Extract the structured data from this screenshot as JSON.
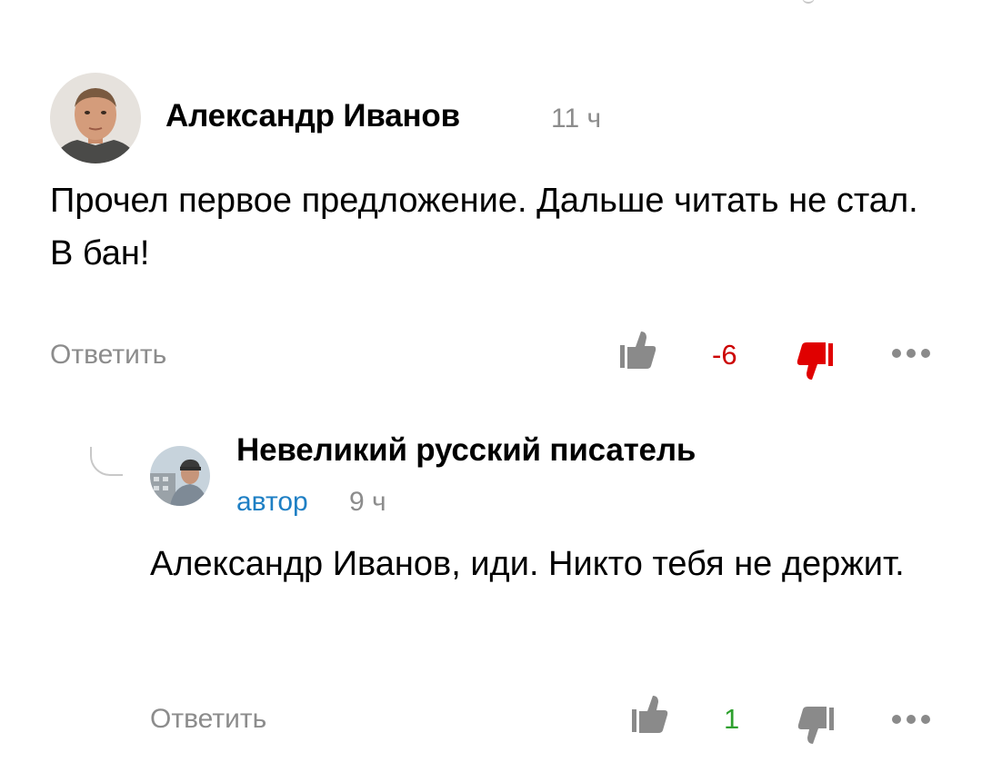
{
  "comments": [
    {
      "author": "Александр Иванов",
      "time": "11 ч",
      "text": "Прочел первое предложение. Дальше читать не стал. В бан!",
      "reply_label": "Ответить",
      "score": "-6",
      "score_color": "#cc0000",
      "dislike_active": true,
      "dislike_color": "#e00000"
    },
    {
      "author": "Невеликий русский писатель",
      "badge": "автор",
      "badge_color": "#1e7fc4",
      "time": "9 ч",
      "text": "Александр Иванов, иди. Никто тебя не держит.",
      "reply_label": "Ответить",
      "score": "1",
      "score_color": "#2ea02e",
      "dislike_active": false
    }
  ],
  "icons": {
    "like": "thumbs-up-icon",
    "dislike": "thumbs-down-icon",
    "more": "more-dots-icon",
    "thread": "reply-thread-line-icon"
  },
  "colors": {
    "muted_text": "#8c8c8c",
    "icon_gray": "#8a8a8a"
  }
}
